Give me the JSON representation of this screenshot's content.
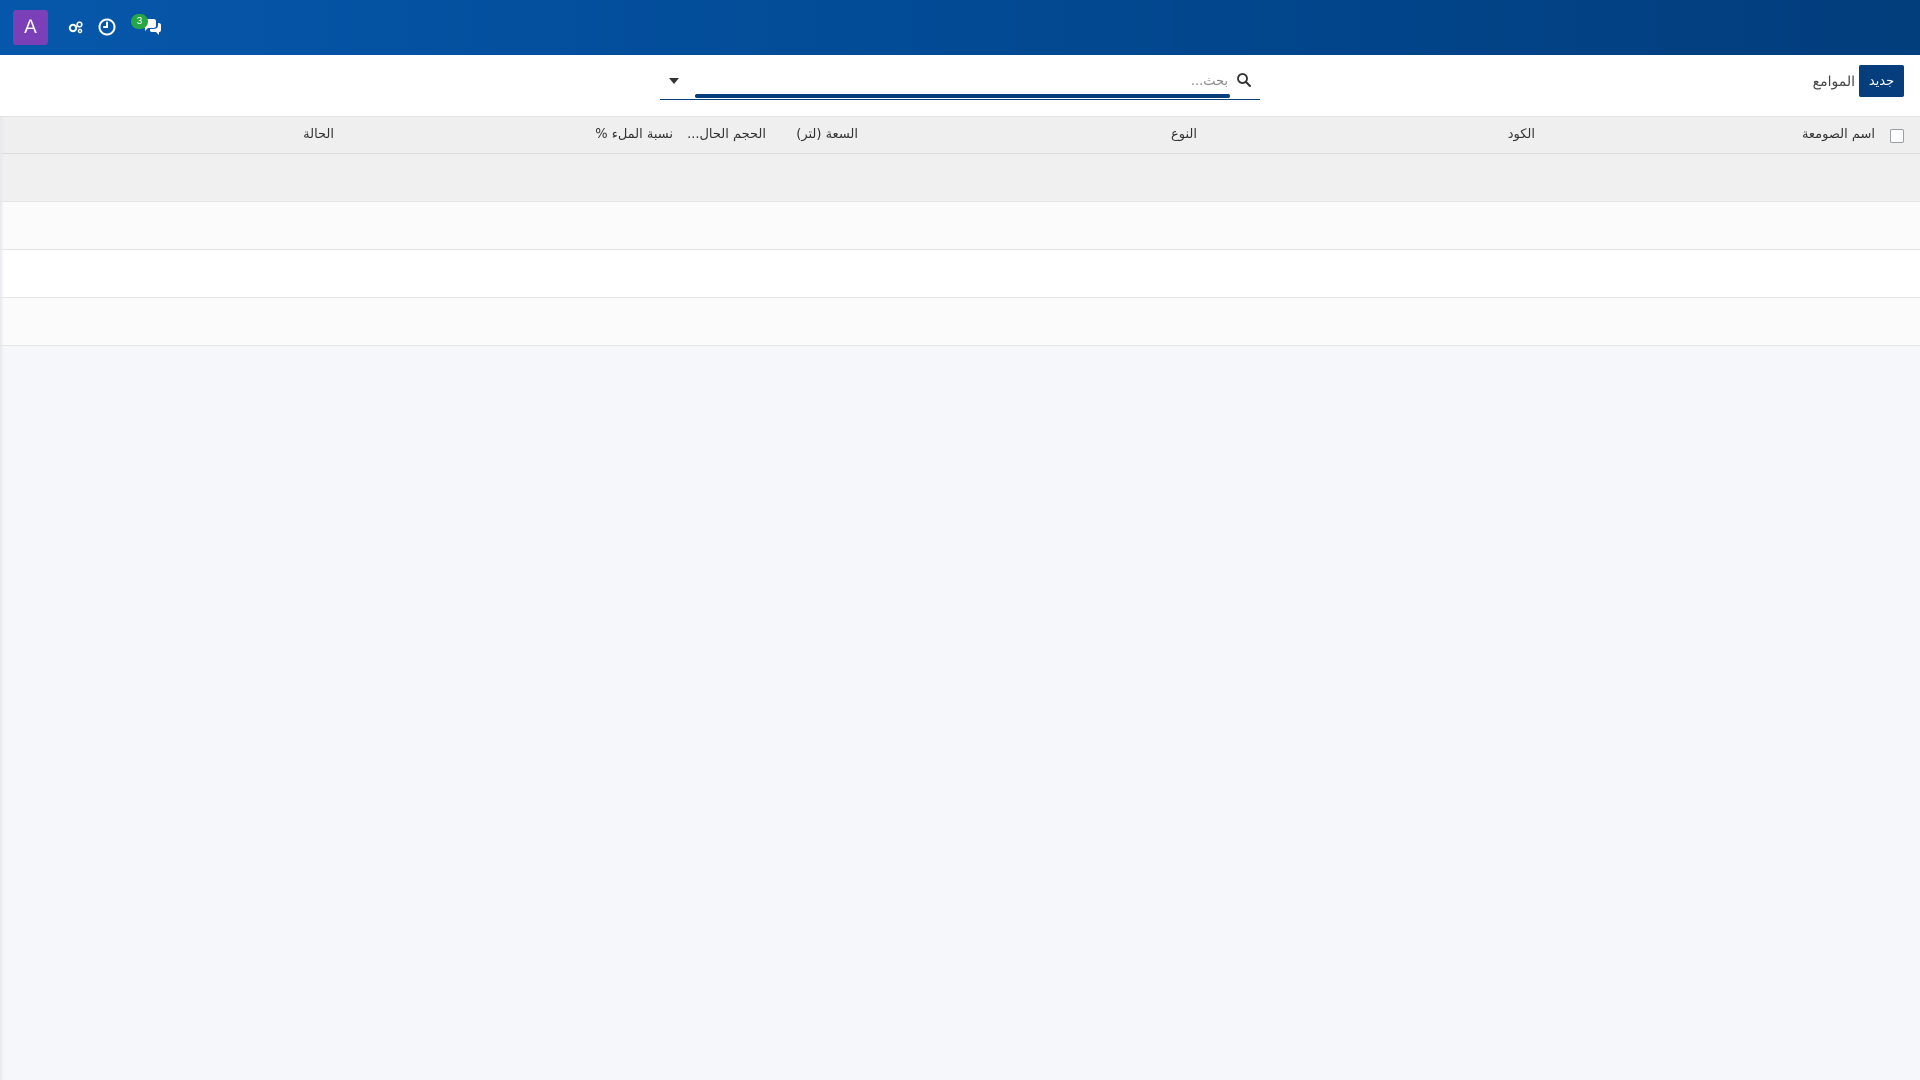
{
  "navbar": {
    "avatar_letter": "A",
    "avatar_color": "#7b3fb8",
    "background_color": "#0657ab",
    "icons": [
      "gears-icon",
      "clock-icon",
      "chat-icon"
    ],
    "chat_badge_count": "3",
    "badge_color": "#26a745"
  },
  "control_panel": {
    "new_button_label": "جديد",
    "breadcrumb": "الموامع",
    "button_color": "#063d7c"
  },
  "search": {
    "placeholder": "بحث...",
    "value": ""
  },
  "table": {
    "columns": [
      {
        "key": "name",
        "label": "اسم الصومعة"
      },
      {
        "key": "code",
        "label": "الكود"
      },
      {
        "key": "type",
        "label": "النوع"
      },
      {
        "key": "capacity",
        "label": "السعة (لتر)"
      },
      {
        "key": "current_volume",
        "label": "الحجم الحال..."
      },
      {
        "key": "fill_ratio",
        "label": "نسبة الملء %"
      },
      {
        "key": "status",
        "label": "الحالة"
      }
    ],
    "rows": [
      {
        "name": "",
        "code": "",
        "type": "",
        "capacity": "",
        "current_volume": "",
        "fill_ratio": "",
        "status": ""
      },
      {
        "name": "",
        "code": "",
        "type": "",
        "capacity": "",
        "current_volume": "",
        "fill_ratio": "",
        "status": ""
      },
      {
        "name": "",
        "code": "",
        "type": "",
        "capacity": "",
        "current_volume": "",
        "fill_ratio": "",
        "status": ""
      },
      {
        "name": "",
        "code": "",
        "type": "",
        "capacity": "",
        "current_volume": "",
        "fill_ratio": "",
        "status": ""
      }
    ]
  }
}
